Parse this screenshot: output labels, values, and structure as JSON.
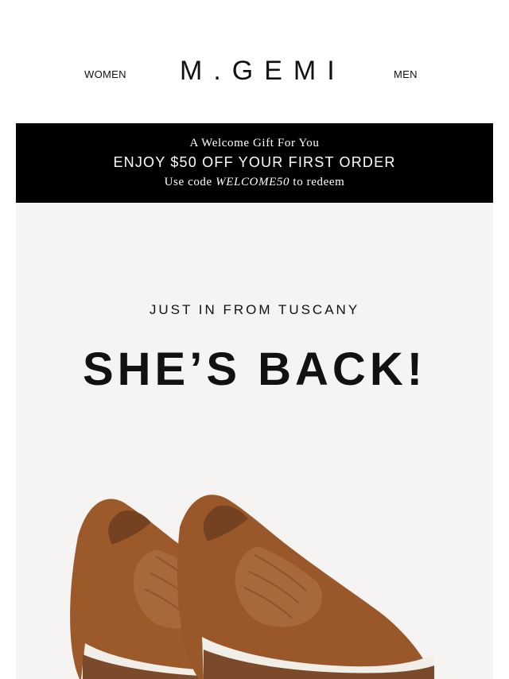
{
  "header": {
    "nav_left": "WOMEN",
    "brand": "M.GEMI",
    "nav_right": "MEN"
  },
  "promo": {
    "line1": "A Welcome Gift For You",
    "line2": "ENJOY $50 OFF YOUR FIRST ORDER",
    "line3_prefix": "Use code",
    "line3_code": "WELCOME50",
    "line3_suffix": "to redeem"
  },
  "hero": {
    "kicker": "JUST IN FROM TUSCANY",
    "headline": "SHE’S BACK!",
    "image_alt_name": "loafer-pair-image",
    "colors": {
      "background": "#f6f4f2",
      "leather": "#9c5a2b",
      "sole": "#7a4a2a",
      "trim": "#f1eee8"
    }
  }
}
